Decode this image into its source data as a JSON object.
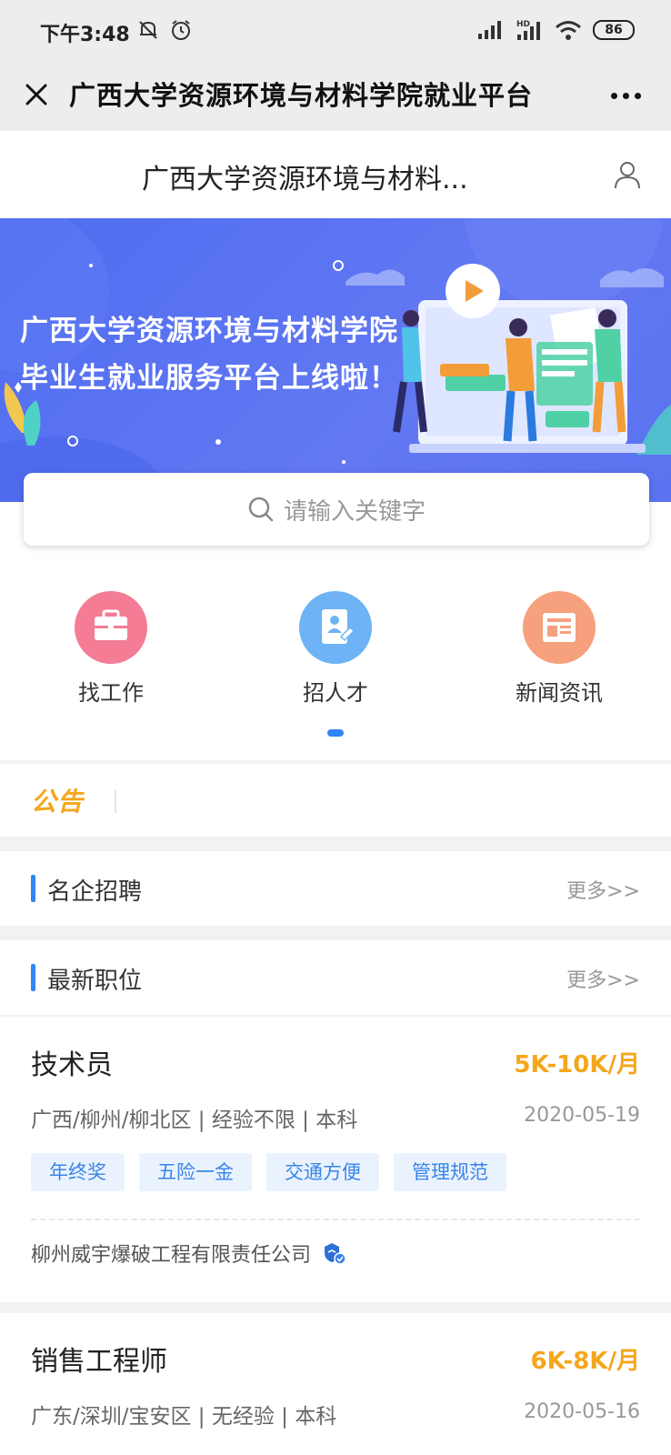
{
  "status_bar": {
    "time": "下午3:48",
    "battery": "86",
    "signal_tag": "HD"
  },
  "title_bar": {
    "title": "广西大学资源环境与材料学院就业平台"
  },
  "page_header": {
    "title": "广西大学资源环境与材料..."
  },
  "banner": {
    "line1": "广西大学资源环境与材料学院",
    "line2": "毕业生就业服务平台上线啦！"
  },
  "search": {
    "placeholder": "请输入关键字"
  },
  "quick_links": [
    {
      "label": "找工作",
      "icon": "briefcase-icon",
      "color": "#f47c95"
    },
    {
      "label": "招人才",
      "icon": "resume-icon",
      "color": "#6db3f5"
    },
    {
      "label": "新闻资讯",
      "icon": "news-icon",
      "color": "#f6a07e"
    }
  ],
  "notice": {
    "label": "公告"
  },
  "sections": {
    "famous": {
      "title": "名企招聘",
      "more": "更多>>"
    },
    "latest": {
      "title": "最新职位",
      "more": "更多>>"
    }
  },
  "jobs": [
    {
      "title": "技术员",
      "salary": "5K-10K/月",
      "meta": "广西/柳州/柳北区 | 经验不限 | 本科",
      "date": "2020-05-19",
      "tags": [
        "年终奖",
        "五险一金",
        "交通方便",
        "管理规范"
      ],
      "company": "柳州威宇爆破工程有限责任公司"
    },
    {
      "title": "销售工程师",
      "salary": "6K-8K/月",
      "meta": "广东/深圳/宝安区 | 无经验 | 本科",
      "date": "2020-05-16"
    }
  ],
  "colors": {
    "accent": "#2f86f6",
    "salary": "#f5a61b",
    "banner": "#5b73f0"
  }
}
